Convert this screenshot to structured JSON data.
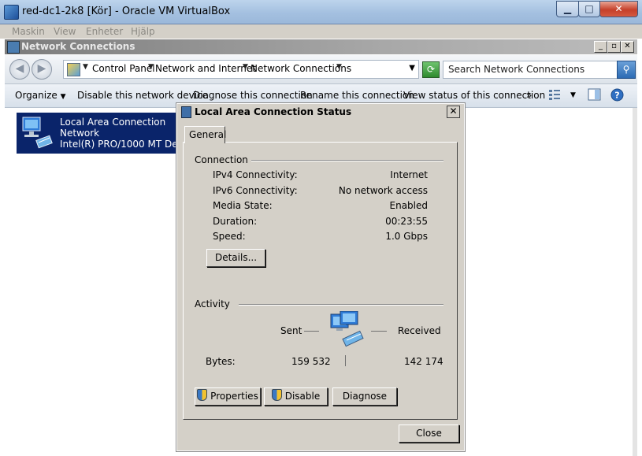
{
  "vbox": {
    "title": "red-dc1-2k8 [Kör] - Oracle VM VirtualBox",
    "min_glyph": "▁",
    "max_glyph": "□",
    "close_glyph": "✕",
    "menu": [
      "Maskin",
      "View",
      "Enheter",
      "Hjälp"
    ]
  },
  "explorer": {
    "title": "Network Connections",
    "win_buttons": [
      "_",
      "▫",
      "✕"
    ],
    "address": {
      "crumbs": [
        "Control Panel",
        "Network and Internet",
        "Network Connections"
      ]
    },
    "search_placeholder": "Search Network Connections",
    "commands": [
      "Organize",
      "Disable this network device",
      "Diagnose this connection",
      "Rename this connection",
      "View status of this connection",
      "»"
    ],
    "item": {
      "name": "Local Area Connection",
      "network": "Network",
      "adapter": "Intel(R) PRO/1000 MT Desktop"
    }
  },
  "dialog": {
    "title": "Local Area Connection Status",
    "close_glyph": "✕",
    "tab": "General",
    "connection_label": "Connection",
    "rows": [
      {
        "k": "IPv4 Connectivity:",
        "v": "Internet"
      },
      {
        "k": "IPv6 Connectivity:",
        "v": "No network access"
      },
      {
        "k": "Media State:",
        "v": "Enabled"
      },
      {
        "k": "Duration:",
        "v": "00:23:55"
      },
      {
        "k": "Speed:",
        "v": "1.0 Gbps"
      }
    ],
    "details_button": "Details...",
    "activity_label": "Activity",
    "sent_label": "Sent",
    "received_label": "Received",
    "bytes_label": "Bytes:",
    "bytes_sent": "159 532",
    "bytes_received": "142 174",
    "properties_button": "Properties",
    "disable_button": "Disable",
    "diagnose_button": "Diagnose",
    "close_button": "Close"
  }
}
